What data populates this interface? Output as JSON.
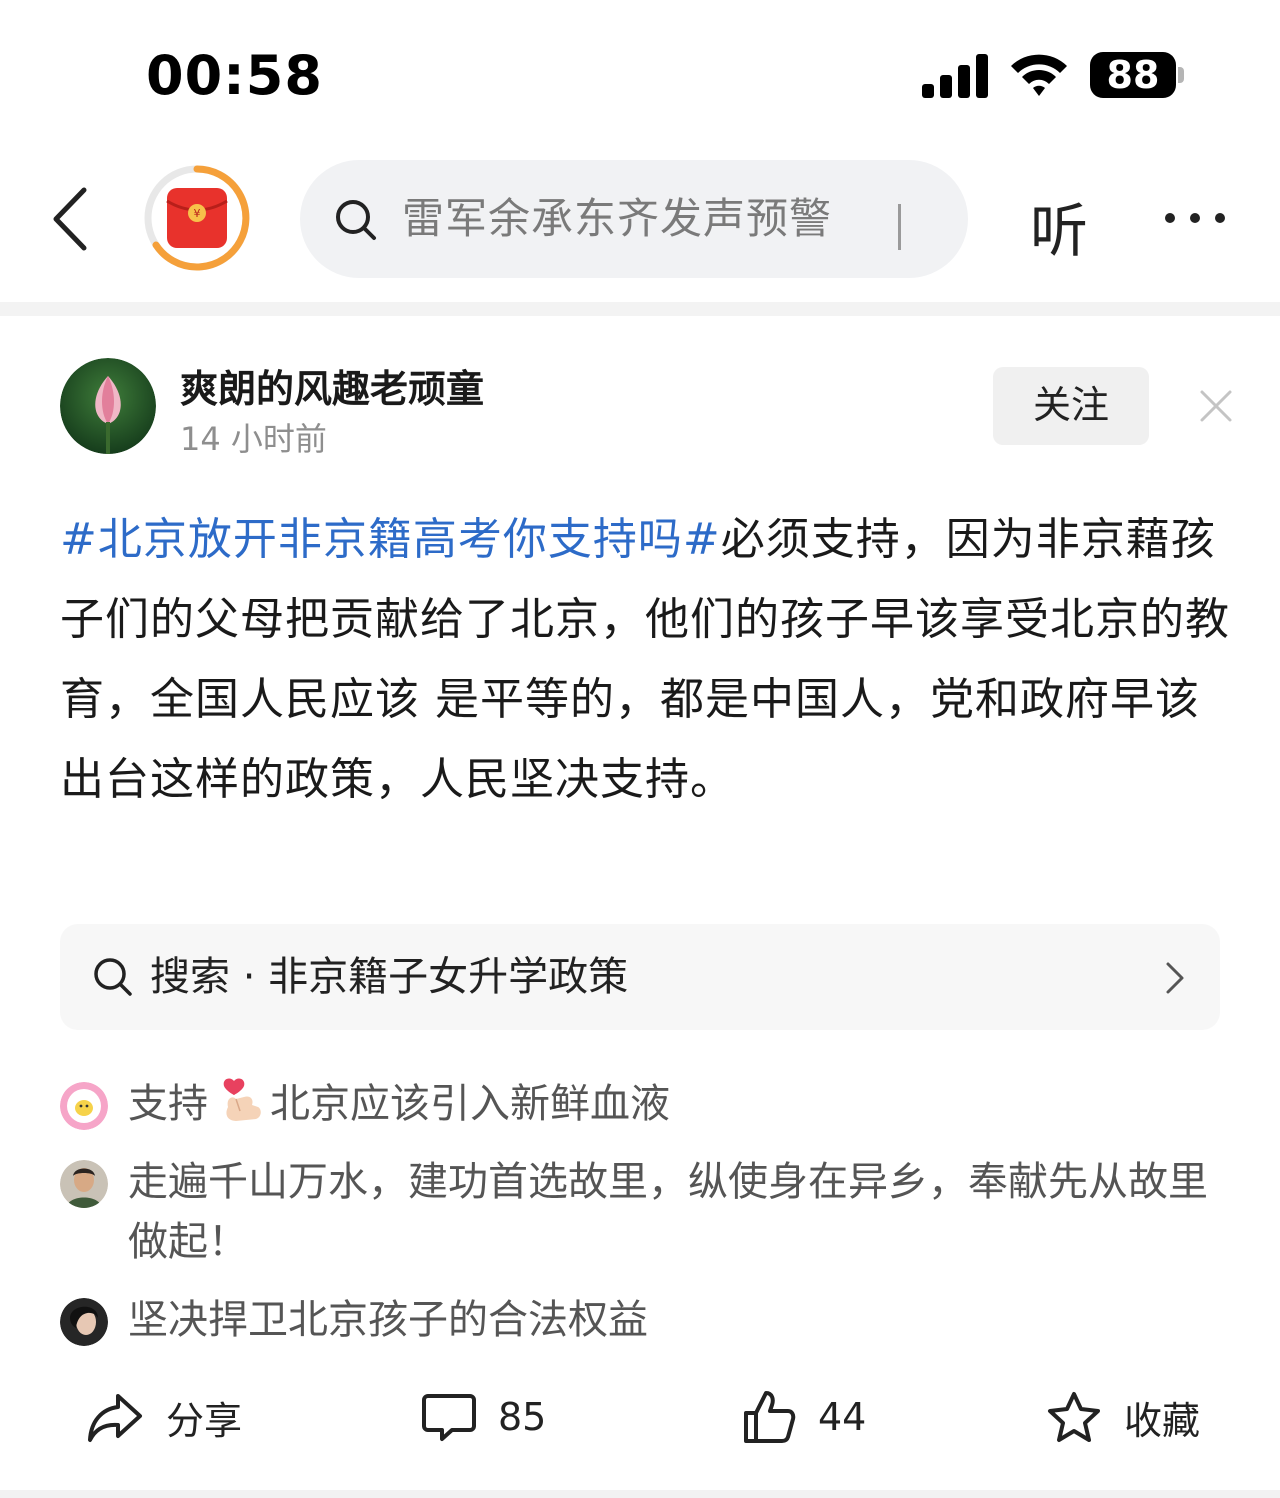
{
  "status_bar": {
    "time": "00:58",
    "battery": "88"
  },
  "header": {
    "search_placeholder": "雷军余承东齐发声预警",
    "listen_label": "听"
  },
  "post": {
    "author": "爽朗的风趣老顽童",
    "time": "14 小时前",
    "follow_label": "关注",
    "hashtag": "#北京放开非京籍高考你支持吗#",
    "body": "必须支持，因为非京藉孩子们的父母把贡献给了北京，他们的孩子早该享受北京的教育，全国人民应该 是平等的，都是中国人，党和政府早该出台这样的政策，人民坚决支持。"
  },
  "related_search": {
    "label": "搜索 · 非京籍子女升学政策"
  },
  "comments": [
    {
      "text_before": "支持",
      "text_after": "北京应该引入新鲜血液",
      "emoji": "heart-hands-emoji"
    },
    {
      "text": "走遍千山万水，建功首选故里，纵使身在异乡，奉献先从故里做起！"
    },
    {
      "text": "坚决捍卫北京孩子的合法权益"
    }
  ],
  "actions": {
    "share": "分享",
    "comments": "85",
    "likes": "44",
    "favorite": "收藏"
  },
  "colors": {
    "hashtag": "#2d6bc8",
    "accent_orange": "#f5a03a",
    "redpacket": "#e8322c"
  }
}
